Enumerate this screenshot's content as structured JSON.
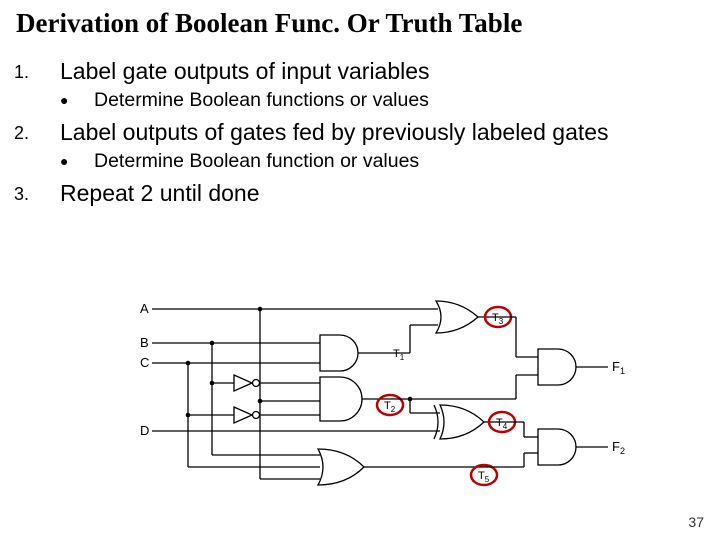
{
  "title": "Derivation of Boolean Func. Or Truth Table",
  "items": [
    {
      "num": "1.",
      "text": "Label gate outputs of input variables",
      "sub": "Determine Boolean functions or values"
    },
    {
      "num": "2.",
      "text": "Label outputs of gates fed by previously labeled gates",
      "sub": "Determine Boolean function or values"
    },
    {
      "num": "3.",
      "text": "Repeat 2 until done",
      "sub": null
    }
  ],
  "diagram": {
    "inputs": [
      "A",
      "B",
      "C",
      "D"
    ],
    "outputs": [
      "F",
      "F"
    ],
    "output_subs": [
      "1",
      "2"
    ],
    "t_labels": [
      "T",
      "T",
      "T",
      "T",
      "T"
    ],
    "t_subs": [
      "3",
      "1",
      "2",
      "4",
      "5"
    ]
  },
  "page_number": "37"
}
